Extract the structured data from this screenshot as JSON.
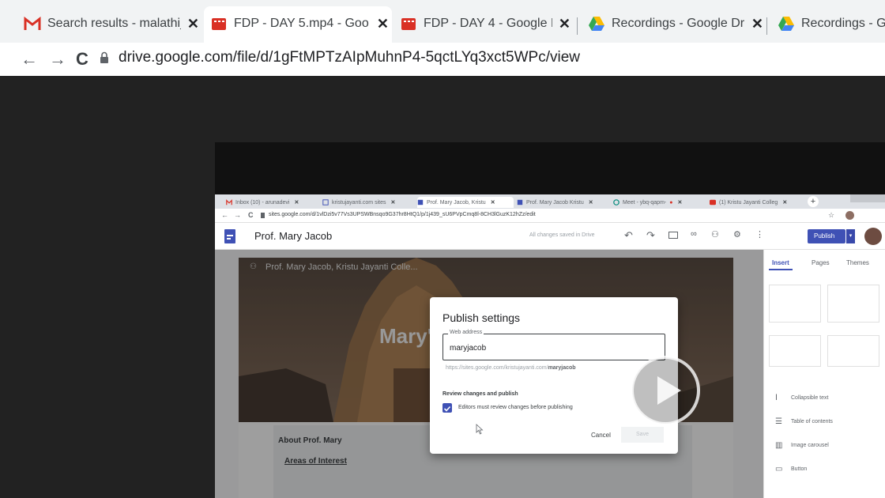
{
  "browser": {
    "tabs": [
      {
        "title": "Search results - malathi_",
        "icon": "gmail-icon"
      },
      {
        "title": "FDP - DAY 5.mp4 - Goo",
        "icon": "video-file-icon"
      },
      {
        "title": "FDP - DAY 4 - Google D",
        "icon": "video-file-icon"
      },
      {
        "title": "Recordings - Google Dri",
        "icon": "drive-icon"
      },
      {
        "title": "Recordings - Goo",
        "icon": "drive-icon"
      }
    ],
    "close_glyph": "✕",
    "back_glyph": "←",
    "forward_glyph": "→",
    "reload_glyph": "C",
    "url": "drive.google.com/file/d/1gFtMPTzAIpMuhnP4-5qctLYq3xct5WPc/view"
  },
  "video": {
    "inner_browser": {
      "tabs": [
        {
          "title": "Inbox (10) - arunadevi",
          "icon": "gmail-icon"
        },
        {
          "title": "kristujayanti.com sites",
          "icon": "sites-icon"
        },
        {
          "title": "Prof. Mary Jacob, Kristu",
          "icon": "sites-icon"
        },
        {
          "title": "Prof. Mary Jacob Kristu",
          "icon": "sites-icon"
        },
        {
          "title": "Meet - ybq-qapm-",
          "icon": "meet-icon"
        },
        {
          "title": "(1) Kristu Jayanti Colleg",
          "icon": "youtube-icon"
        }
      ],
      "url": "sites.google.com/d/1vlDzi5v77Vs3UPSWBnsqo9G37hr8HtQ1/p/1j439_sU6PVpCmq8l-8CH3lGuzK12hZz/edit"
    },
    "editor": {
      "site_title": "Prof. Mary Jacob",
      "status_text": "All changes saved in Drive",
      "publish_label": "Publish",
      "page_header": "Prof. Mary Jacob, Kristu Jayanti Colle...",
      "hero_title": "Mary's",
      "about_title": "About Prof. Mary",
      "areas_title": "Areas of Interest",
      "side_tabs": [
        "Insert",
        "Pages",
        "Themes"
      ],
      "side_items": [
        "Collapsible text",
        "Table of contents",
        "Image carousel",
        "Button"
      ]
    },
    "dialog": {
      "title": "Publish settings",
      "web_address_label": "Web address",
      "web_address_value": "maryjacob",
      "url_prefix": "https://sites.google.com/kristujayanti.com/",
      "url_suffix": "maryjacob",
      "review_heading": "Review changes and publish",
      "checkbox_label": "Editors must review changes before publishing",
      "checkbox_checked": true,
      "cancel_label": "Cancel",
      "save_label": "Save"
    },
    "play_icon": "play-icon"
  },
  "colors": {
    "gmail_red": "#d93025",
    "video_red": "#d93025",
    "sites_blue": "#3f51b5",
    "publish_blue": "#3f51b5",
    "checkbox_blue": "#3f51b5",
    "drive_yellow": "#fbbc04",
    "drive_green": "#34a853",
    "drive_blue": "#4285f4"
  }
}
